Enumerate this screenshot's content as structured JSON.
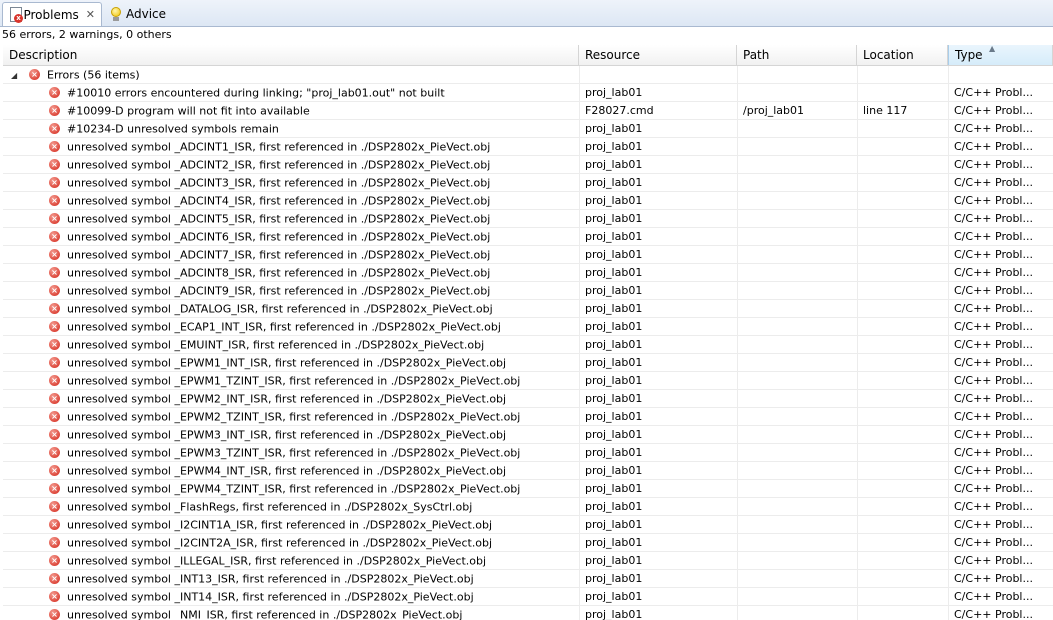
{
  "tabs": [
    {
      "label": "Problems",
      "icon": "problems-icon",
      "active": true,
      "close": "✕"
    },
    {
      "label": "Advice",
      "icon": "lightbulb-icon",
      "active": false
    }
  ],
  "summary": "56 errors, 2 warnings, 0 others",
  "columns": [
    "Description",
    "Resource",
    "Path",
    "Location",
    "Type"
  ],
  "sorted_column": "Type",
  "group": {
    "label": "Errors (56 items)",
    "expanded": true
  },
  "rows": [
    {
      "desc": "#10010 errors encountered during linking; \"proj_lab01.out\" not built",
      "res": "proj_lab01",
      "path": "",
      "loc": "",
      "type": "C/C++ Probl..."
    },
    {
      "desc": "#10099-D program will not fit into available",
      "res": "F28027.cmd",
      "path": "/proj_lab01",
      "loc": "line 117",
      "type": "C/C++ Probl..."
    },
    {
      "desc": "#10234-D unresolved symbols remain",
      "res": "proj_lab01",
      "path": "",
      "loc": "",
      "type": "C/C++ Probl..."
    },
    {
      "desc": "unresolved symbol _ADCINT1_ISR, first referenced in ./DSP2802x_PieVect.obj",
      "res": "proj_lab01",
      "path": "",
      "loc": "",
      "type": "C/C++ Probl..."
    },
    {
      "desc": "unresolved symbol _ADCINT2_ISR, first referenced in ./DSP2802x_PieVect.obj",
      "res": "proj_lab01",
      "path": "",
      "loc": "",
      "type": "C/C++ Probl..."
    },
    {
      "desc": "unresolved symbol _ADCINT3_ISR, first referenced in ./DSP2802x_PieVect.obj",
      "res": "proj_lab01",
      "path": "",
      "loc": "",
      "type": "C/C++ Probl..."
    },
    {
      "desc": "unresolved symbol _ADCINT4_ISR, first referenced in ./DSP2802x_PieVect.obj",
      "res": "proj_lab01",
      "path": "",
      "loc": "",
      "type": "C/C++ Probl..."
    },
    {
      "desc": "unresolved symbol _ADCINT5_ISR, first referenced in ./DSP2802x_PieVect.obj",
      "res": "proj_lab01",
      "path": "",
      "loc": "",
      "type": "C/C++ Probl..."
    },
    {
      "desc": "unresolved symbol _ADCINT6_ISR, first referenced in ./DSP2802x_PieVect.obj",
      "res": "proj_lab01",
      "path": "",
      "loc": "",
      "type": "C/C++ Probl..."
    },
    {
      "desc": "unresolved symbol _ADCINT7_ISR, first referenced in ./DSP2802x_PieVect.obj",
      "res": "proj_lab01",
      "path": "",
      "loc": "",
      "type": "C/C++ Probl..."
    },
    {
      "desc": "unresolved symbol _ADCINT8_ISR, first referenced in ./DSP2802x_PieVect.obj",
      "res": "proj_lab01",
      "path": "",
      "loc": "",
      "type": "C/C++ Probl..."
    },
    {
      "desc": "unresolved symbol _ADCINT9_ISR, first referenced in ./DSP2802x_PieVect.obj",
      "res": "proj_lab01",
      "path": "",
      "loc": "",
      "type": "C/C++ Probl..."
    },
    {
      "desc": "unresolved symbol _DATALOG_ISR, first referenced in ./DSP2802x_PieVect.obj",
      "res": "proj_lab01",
      "path": "",
      "loc": "",
      "type": "C/C++ Probl..."
    },
    {
      "desc": "unresolved symbol _ECAP1_INT_ISR, first referenced in ./DSP2802x_PieVect.obj",
      "res": "proj_lab01",
      "path": "",
      "loc": "",
      "type": "C/C++ Probl..."
    },
    {
      "desc": "unresolved symbol _EMUINT_ISR, first referenced in ./DSP2802x_PieVect.obj",
      "res": "proj_lab01",
      "path": "",
      "loc": "",
      "type": "C/C++ Probl..."
    },
    {
      "desc": "unresolved symbol _EPWM1_INT_ISR, first referenced in ./DSP2802x_PieVect.obj",
      "res": "proj_lab01",
      "path": "",
      "loc": "",
      "type": "C/C++ Probl..."
    },
    {
      "desc": "unresolved symbol _EPWM1_TZINT_ISR, first referenced in ./DSP2802x_PieVect.obj",
      "res": "proj_lab01",
      "path": "",
      "loc": "",
      "type": "C/C++ Probl..."
    },
    {
      "desc": "unresolved symbol _EPWM2_INT_ISR, first referenced in ./DSP2802x_PieVect.obj",
      "res": "proj_lab01",
      "path": "",
      "loc": "",
      "type": "C/C++ Probl..."
    },
    {
      "desc": "unresolved symbol _EPWM2_TZINT_ISR, first referenced in ./DSP2802x_PieVect.obj",
      "res": "proj_lab01",
      "path": "",
      "loc": "",
      "type": "C/C++ Probl..."
    },
    {
      "desc": "unresolved symbol _EPWM3_INT_ISR, first referenced in ./DSP2802x_PieVect.obj",
      "res": "proj_lab01",
      "path": "",
      "loc": "",
      "type": "C/C++ Probl..."
    },
    {
      "desc": "unresolved symbol _EPWM3_TZINT_ISR, first referenced in ./DSP2802x_PieVect.obj",
      "res": "proj_lab01",
      "path": "",
      "loc": "",
      "type": "C/C++ Probl..."
    },
    {
      "desc": "unresolved symbol _EPWM4_INT_ISR, first referenced in ./DSP2802x_PieVect.obj",
      "res": "proj_lab01",
      "path": "",
      "loc": "",
      "type": "C/C++ Probl..."
    },
    {
      "desc": "unresolved symbol _EPWM4_TZINT_ISR, first referenced in ./DSP2802x_PieVect.obj",
      "res": "proj_lab01",
      "path": "",
      "loc": "",
      "type": "C/C++ Probl..."
    },
    {
      "desc": "unresolved symbol _FlashRegs, first referenced in ./DSP2802x_SysCtrl.obj",
      "res": "proj_lab01",
      "path": "",
      "loc": "",
      "type": "C/C++ Probl..."
    },
    {
      "desc": "unresolved symbol _I2CINT1A_ISR, first referenced in ./DSP2802x_PieVect.obj",
      "res": "proj_lab01",
      "path": "",
      "loc": "",
      "type": "C/C++ Probl..."
    },
    {
      "desc": "unresolved symbol _I2CINT2A_ISR, first referenced in ./DSP2802x_PieVect.obj",
      "res": "proj_lab01",
      "path": "",
      "loc": "",
      "type": "C/C++ Probl..."
    },
    {
      "desc": "unresolved symbol _ILLEGAL_ISR, first referenced in ./DSP2802x_PieVect.obj",
      "res": "proj_lab01",
      "path": "",
      "loc": "",
      "type": "C/C++ Probl..."
    },
    {
      "desc": "unresolved symbol _INT13_ISR, first referenced in ./DSP2802x_PieVect.obj",
      "res": "proj_lab01",
      "path": "",
      "loc": "",
      "type": "C/C++ Probl..."
    },
    {
      "desc": "unresolved symbol _INT14_ISR, first referenced in ./DSP2802x_PieVect.obj",
      "res": "proj_lab01",
      "path": "",
      "loc": "",
      "type": "C/C++ Probl..."
    },
    {
      "desc": "unresolved symbol _NMI_ISR, first referenced in ./DSP2802x_PieVect.obj",
      "res": "proj_lab01",
      "path": "",
      "loc": "",
      "type": "C/C++ Probl..."
    }
  ]
}
